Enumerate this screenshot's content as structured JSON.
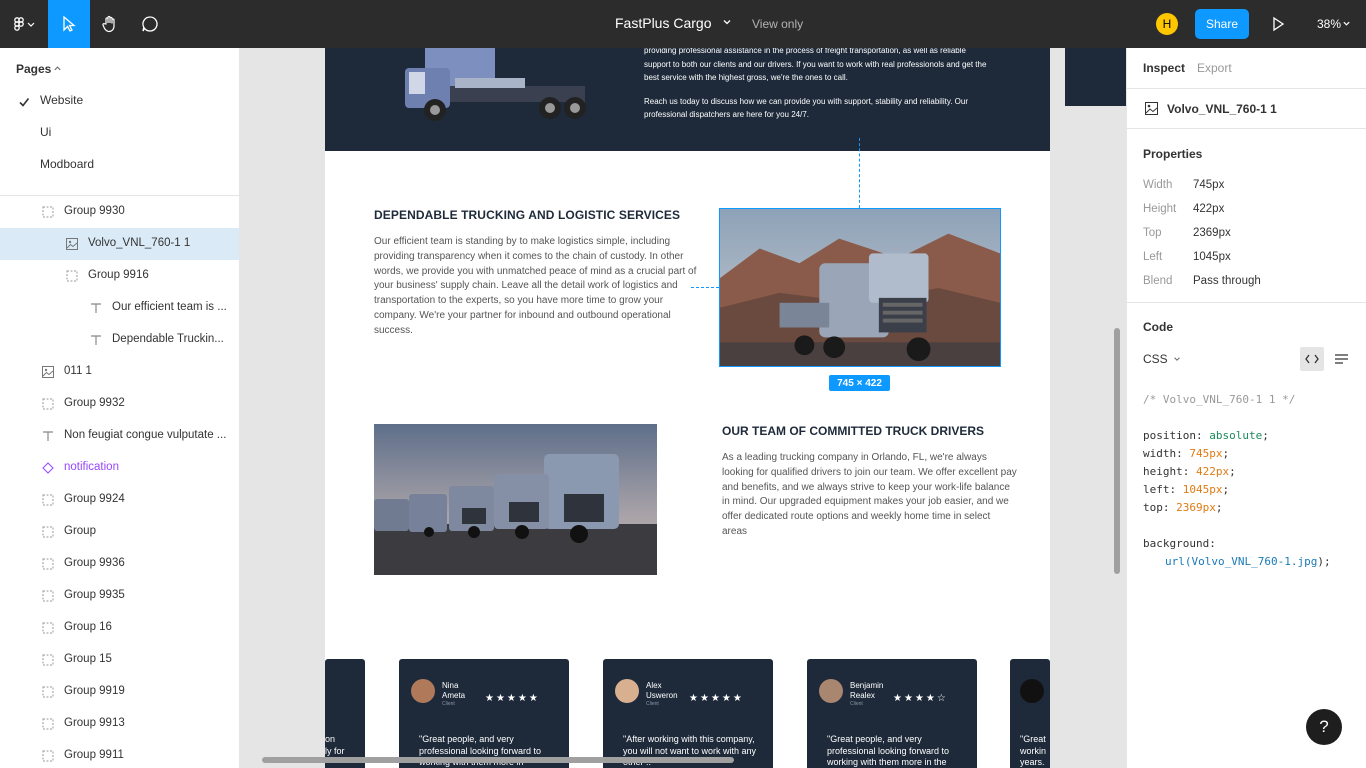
{
  "toolbar": {
    "file_title": "FastPlus Cargo",
    "view_only": "View only",
    "avatar_initial": "H",
    "share_label": "Share",
    "zoom": "38%"
  },
  "pages": {
    "heading": "Pages",
    "items": [
      "Website",
      "Ui",
      "Modboard"
    ]
  },
  "layers": [
    {
      "name": "Group 9930",
      "icon": "group-icon"
    },
    {
      "name": "Volvo_VNL_760-1 1",
      "icon": "image-icon",
      "selected": true
    },
    {
      "name": "Group 9916",
      "icon": "group-icon"
    },
    {
      "name": "Our efficient team is ...",
      "icon": "text-icon"
    },
    {
      "name": "Dependable Truckin...",
      "icon": "text-icon"
    },
    {
      "name": "011 1",
      "icon": "image-icon"
    },
    {
      "name": "Group 9932",
      "icon": "group-icon"
    },
    {
      "name": "Non feugiat congue vulputate ...",
      "icon": "text-icon"
    },
    {
      "name": "notification",
      "icon": "component-icon"
    },
    {
      "name": "Group 9924",
      "icon": "group-icon"
    },
    {
      "name": "Group",
      "icon": "group-icon"
    },
    {
      "name": "Group 9936",
      "icon": "group-icon"
    },
    {
      "name": "Group 9935",
      "icon": "group-icon"
    },
    {
      "name": "Group 16",
      "icon": "group-icon"
    },
    {
      "name": "Group 15",
      "icon": "group-icon"
    },
    {
      "name": "Group 9919",
      "icon": "group-icon"
    },
    {
      "name": "Group 9913",
      "icon": "group-icon"
    },
    {
      "name": "Group 9911",
      "icon": "group-icon"
    }
  ],
  "canvas": {
    "top_text": [
      "providing professional assistance in the process of freight transportation, as well as reliable support to both our clients and our drivers. If you want to work with real professionols and get the best service with the highest gross, we're the ones to call.",
      "Reach us today to discuss how we can provide you with support, stability and reliability. Our professional dispatchers are here for you 24/7."
    ],
    "section1": {
      "title": "DEPENDABLE TRUCKING AND LOGISTIC SERVICES",
      "body": "Our efficient team is standing by to make logistics simple, including providing transparency when it comes to the chain of custody. In other words, we provide you with unmatched peace of mind as a crucial part of your business' supply chain. Leave all the detail work of logistics and transportation to the experts, so you have more time to grow your company. We're your partner for inbound and outbound operational success."
    },
    "size_badge": "745 × 422",
    "section2": {
      "title": "OUR TEAM OF COMMITTED TRUCK DRIVERS",
      "body": "As a leading trucking company in Orlando, FL, we're always looking for qualified drivers to join our team. We offer excellent pay and benefits, and we always strive to keep your work-life balance in mind. Our upgraded equipment makes your job easier, and we offer dedicated route options and weekly home time in select areas"
    },
    "cards": [
      {
        "name": "Nina Ameta",
        "role": "Client",
        "stars": 5,
        "quote": "\"Great people, and very professional looking forward to working with them more in"
      },
      {
        "name": "Alex Usweron",
        "role": "Client",
        "stars": 5,
        "quote": "\"After working with this company, you will not want to work with any other ..\""
      },
      {
        "name": "Benjamin Realex",
        "role": "Client",
        "stars": 4,
        "quote": "\"Great people, and very professional looking forward to working with them more in the"
      }
    ],
    "partial_left": {
      "text": "on\nly for"
    },
    "partial_right": {
      "text": "\"Great\nworkin\nyears."
    }
  },
  "inspect": {
    "tab_inspect": "Inspect",
    "tab_export": "Export",
    "layer_name": "Volvo_VNL_760-1 1",
    "properties_heading": "Properties",
    "properties": [
      {
        "label": "Width",
        "value": "745px"
      },
      {
        "label": "Height",
        "value": "422px"
      },
      {
        "label": "Top",
        "value": "2369px"
      },
      {
        "label": "Left",
        "value": "1045px"
      },
      {
        "label": "Blend",
        "value": "Pass through"
      }
    ],
    "code_heading": "Code",
    "code_lang": "CSS",
    "code": {
      "comment": "/* Volvo_VNL_760-1 1 */",
      "position_k": "position:",
      "position_v": "absolute",
      "width_k": "width:",
      "width_v": "745px",
      "height_k": "height:",
      "height_v": "422px",
      "left_k": "left:",
      "left_v": "1045px",
      "top_k": "top:",
      "top_v": "2369px",
      "bg_k": "background:",
      "bg_fn": "url(",
      "bg_v": "Volvo_VNL_760-1.jpg",
      "bg_end": ");"
    }
  },
  "help": "?"
}
